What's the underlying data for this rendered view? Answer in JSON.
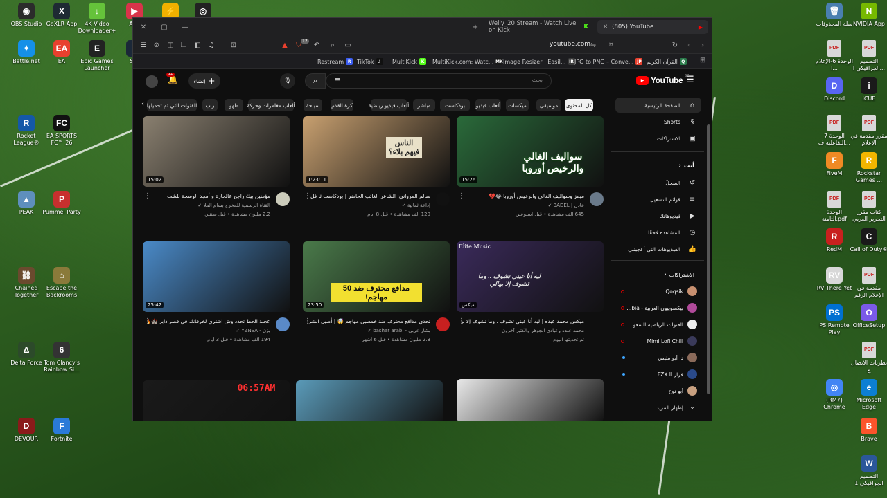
{
  "desktop": {
    "left_icons": [
      {
        "label": "OBS Studio",
        "color": "#2b2b2b",
        "glyph": "◉"
      },
      {
        "label": "GoXLR App",
        "color": "#1e2a33",
        "glyph": "X"
      },
      {
        "label": "4K Video Downloader+",
        "color": "#65c23a",
        "glyph": "↓"
      },
      {
        "label": "Any",
        "color": "#d8344a",
        "glyph": "▶"
      },
      {
        "label": "",
        "color": "#f0b000",
        "glyph": "⚡"
      },
      {
        "label": "",
        "color": "#222",
        "glyph": "◎"
      },
      {
        "label": "Battle.net",
        "color": "#1590e8",
        "glyph": "✦"
      },
      {
        "label": "EA",
        "color": "#e8402e",
        "glyph": "EA"
      },
      {
        "label": "Epic Games Launcher",
        "color": "#222",
        "glyph": "E"
      },
      {
        "label": "Ste",
        "color": "#1b2838",
        "glyph": "S"
      },
      {
        "label": "Rocket League®",
        "color": "#1458a8",
        "glyph": "R"
      },
      {
        "label": "EA SPORTS FC™ 26",
        "color": "#111",
        "glyph": "FC"
      },
      {
        "label": "PEAK",
        "color": "#5e8fbd",
        "glyph": "▲"
      },
      {
        "label": "Pummel Party",
        "color": "#c8302e",
        "glyph": "P"
      },
      {
        "label": "Chained Together",
        "color": "#6a4a2e",
        "glyph": "⛓"
      },
      {
        "label": "Escape the Backrooms",
        "color": "#8a7a3a",
        "glyph": "⌂"
      },
      {
        "label": "Delta Force",
        "color": "#2c4a2a",
        "glyph": "Δ"
      },
      {
        "label": "Tom Clancy's Rainbow Si...",
        "color": "#333",
        "glyph": "6"
      },
      {
        "label": "DEVOUR",
        "color": "#8a1a1a",
        "glyph": "D"
      },
      {
        "label": "Fortnite",
        "color": "#2a7ad8",
        "glyph": "F"
      }
    ],
    "right_icons": [
      {
        "label": "سلة المحذوفات",
        "color": "#4a7fb0",
        "glyph": "🗑"
      },
      {
        "label": "NVIDIA App",
        "color": "#76b900",
        "glyph": "N"
      },
      {
        "label": "الوحدة 6-الإعلام ا...",
        "color": "#d8d8d8",
        "glyph": "PDF"
      },
      {
        "label": "التصميم الجرافيكي ا...",
        "color": "#d8d8d8",
        "glyph": "PDF"
      },
      {
        "label": "Discord",
        "color": "#5865f2",
        "glyph": "D"
      },
      {
        "label": "iCUE",
        "color": "#1a1a1a",
        "glyph": "i"
      },
      {
        "label": "الوحدة 7 التفاعلية ف...",
        "color": "#d8d8d8",
        "glyph": "PDF"
      },
      {
        "label": "مقرر مقدمة في الإعلام",
        "color": "#d8d8d8",
        "glyph": "PDF"
      },
      {
        "label": "FiveM",
        "color": "#f08a24",
        "glyph": "F"
      },
      {
        "label": "Rockstar Games ...",
        "color": "#f2b600",
        "glyph": "R"
      },
      {
        "label": "الوحدة الثامنة.pdf",
        "color": "#d8d8d8",
        "glyph": "PDF"
      },
      {
        "label": "كتاب مقرر التحرير العربي",
        "color": "#d8d8d8",
        "glyph": "PDF"
      },
      {
        "label": "RedM",
        "color": "#c8201e",
        "glyph": "R"
      },
      {
        "label": "Call of Duty®",
        "color": "#1a1a1a",
        "glyph": "C"
      },
      {
        "label": "RV There Yet",
        "color": "#d8d8d8",
        "glyph": "RV"
      },
      {
        "label": "مقدمة في الإعلام الرقم",
        "color": "#d8d8d8",
        "glyph": "PDF"
      },
      {
        "label": "PS Remote Play",
        "color": "#0070d1",
        "glyph": "PS"
      },
      {
        "label": "OfficeSetup",
        "color": "#7a5ae8",
        "glyph": "O"
      },
      {
        "label": "نظريات الاتصال ع",
        "color": "#d8d8d8",
        "glyph": "PDF"
      },
      {
        "label": "(RM7) Chrome",
        "color": "#4285f4",
        "glyph": "◎"
      },
      {
        "label": "Microsoft Edge",
        "color": "#0c7fd3",
        "glyph": "e"
      },
      {
        "label": "Brave",
        "color": "#fb542b",
        "glyph": "B"
      },
      {
        "label": "التصميم الجرافيكي 1",
        "color": "#2b579a",
        "glyph": "W"
      }
    ]
  },
  "browser": {
    "tabs": [
      {
        "title": "Welly_20 Stream - Watch Live on Kick",
        "badge": "K"
      },
      {
        "title": "(805) YouTube",
        "badge": "▶"
      }
    ],
    "url": "youtube.com",
    "shield_count": "12",
    "bookmarks": [
      {
        "label": "Restream",
        "fav": "R",
        "color": "#3a5cf0"
      },
      {
        "label": "TikTok",
        "fav": "♪",
        "color": "#111"
      },
      {
        "label": "MultiKick",
        "fav": "K",
        "color": "#53fc18"
      },
      {
        "label": "MultiKick.com: Watc...",
        "fav": "MK",
        "color": "#1a1a1a"
      },
      {
        "label": "Image Resizer | Easil...",
        "fav": "IR",
        "color": "#3a3a3a"
      },
      {
        "label": "JPG to PNG – Conve...",
        "fav": "JP",
        "color": "#e8402e"
      },
      {
        "label": "القرآن الكريم",
        "fav": "Q",
        "color": "#2a7a4a"
      }
    ]
  },
  "youtube": {
    "logo": "YouTube",
    "region": "SA",
    "search_placeholder": "بحث",
    "create_label": "إنشاء",
    "notif_count": "9+",
    "chips": [
      "كل المحتوى",
      "موسيقى",
      "ميكسات",
      "ألعاب فيديو",
      "بودكاست",
      "مباشر",
      "ألعاب فيديو رياضية",
      "كرة القدم",
      "سياحة",
      "ألعاب مغامرات وحركة",
      "طهو",
      "راب",
      "القنوات التي تم تحميلها"
    ],
    "sidebar": {
      "main": [
        {
          "label": "الصفحة الرئيسية",
          "icon": "⌂"
        },
        {
          "label": "Shorts",
          "icon": "§"
        },
        {
          "label": "الاشتراكات",
          "icon": "▣"
        }
      ],
      "you_heading": "أنت",
      "you": [
        {
          "label": "السجلّ",
          "icon": "↺"
        },
        {
          "label": "قوائم التشغيل",
          "icon": "≡"
        },
        {
          "label": "فيديوهاتك",
          "icon": "▶"
        },
        {
          "label": "المشاهدة لاحقًا",
          "icon": "◷"
        },
        {
          "label": "الفيديوهات التي أعجبتني",
          "icon": "👍"
        }
      ],
      "subs_heading": "الاشتراكات",
      "subs": [
        {
          "label": "Qoqsik",
          "color": "#c89070",
          "dot": "live-red"
        },
        {
          "label": "بيكسوبيون العربية - bia...",
          "color": "#b04a9a",
          "dot": "live-red"
        },
        {
          "label": "القنوات الرياضية السعو...",
          "color": "#eeeeee",
          "dot": "live-red"
        },
        {
          "label": "Mimi Lofi Chill",
          "color": "#3a3a5a",
          "dot": "live-red"
        },
        {
          "label": "د. أبو مليص",
          "color": "#8a6a5a",
          "dot": "new"
        },
        {
          "label": "فراز FZX II",
          "color": "#2a4a8a",
          "dot": "new"
        },
        {
          "label": "أبو نوح",
          "color": "#c8a080",
          "dot": "none"
        }
      ],
      "show_more": "إظهار المزيد"
    },
    "videos": [
      {
        "title": "ميمز وسواليف الغالي والرخيص أوروبا 😂💔",
        "channel": "عادل | 3ADEL ✓",
        "stats": "645 ألف مشاهدة • قبل أسبوعين",
        "duration": "15:26",
        "thumb_text": "سواليف الغالي والرخيص أوروبا",
        "thumb_bg": "#2a6a3a",
        "avatar": "#6a7a8a"
      },
      {
        "title": "سالم المرواني: الشاعر الغائب الحاضر | بودكاست ثا فل",
        "channel": "إذاعة ثمانية ✓",
        "stats": "120 ألف مشاهدة • قبل 8 أيام",
        "duration": "1:23:11",
        "thumb_text": "الناس فيهم بلاء؟",
        "thumb_bg": "#c8a070",
        "avatar": "#111111"
      },
      {
        "title": "مؤمنين بيك راجح عالحارة و أمجد الوسخة بلشت",
        "channel": "القناة الرسمية للمخرج بسام الملا ✓",
        "stats": "2.2 مليون مشاهدة • قبل سنتين",
        "duration": "15:02",
        "thumb_text": "",
        "thumb_bg": "#8a8070",
        "avatar": "#ccccbb"
      },
      {
        "title": "ميكس محمد عبده | ليه أنا عيني تشوف ، وما تشوف إلا بهالي ؟ HQ",
        "channel": "محمد عبده وعبادي الجوهر والكثير آخرون",
        "stats": "تم تحديثها اليوم",
        "duration": "ميكس",
        "thumb_text": "ليه أنا عيني تشوف .. وما تشوف إلا بهالي",
        "thumb_bg": "#3a2a5a",
        "avatar": ""
      },
      {
        "title": "تحدي مدافع محترف ضد خمسين مهاجم 🤯 | أصيل الشريف 🔥",
        "channel": "بشار عربي - bashar arabi ✓",
        "stats": "2.3 مليون مشاهدة • قبل 6 أشهر",
        "duration": "23:50",
        "thumb_text": "مدافع محترف ضد 50 مهاجم!",
        "thumb_bg": "#4a7a4a",
        "avatar": "#c82020"
      },
      {
        "title": "عجلة الحظ تحدد وش اشتري لخرفانك في قصر دابر 🏰🔥",
        "channel": "يزن - YZNSA ✓",
        "stats": "194 ألف مشاهدة • قبل 3 أيام",
        "duration": "25:42",
        "thumb_text": "",
        "thumb_bg": "#4a8ac8",
        "avatar": "#5a8ac8"
      },
      {
        "title": "",
        "channel": "",
        "stats": "",
        "duration": "",
        "thumb_text": "",
        "thumb_bg": "#e8e8e8",
        "avatar": ""
      },
      {
        "title": "",
        "channel": "",
        "stats": "",
        "duration": "",
        "thumb_text": "",
        "thumb_bg": "#5a9ab8",
        "avatar": ""
      },
      {
        "title": "",
        "channel": "",
        "stats": "",
        "duration": "",
        "thumb_text": "06:57AM",
        "thumb_bg": "#1a1a1a",
        "avatar": ""
      }
    ],
    "elite_music": "Elite Music"
  }
}
